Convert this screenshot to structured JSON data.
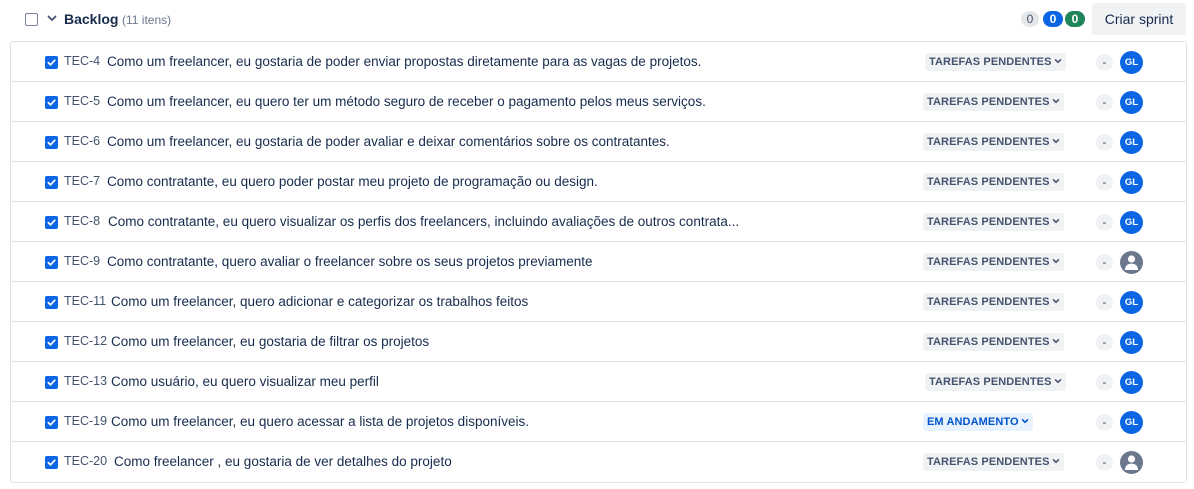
{
  "header": {
    "title": "Backlog",
    "count": "(11 itens)",
    "pill_grey": "0",
    "pill_blue": "0",
    "pill_green": "0",
    "create_sprint": "Criar sprint"
  },
  "colors": {
    "accent_blue": "#0c66e4",
    "done_green": "#1f845a",
    "status_todo_bg": "#f1f2f4",
    "status_progress_bg": "#e9f2ff"
  },
  "issues": [
    {
      "key": "TEC-4",
      "summary": "Como um freelancer, eu gostaria de poder enviar propostas diretamente para as vagas de projetos.",
      "status": "TAREFAS PENDENTES",
      "status_type": "todo",
      "estimate": "-",
      "assignee": "GL"
    },
    {
      "key": "TEC-5",
      "summary": "Como um freelancer, eu quero ter um método seguro de receber o pagamento pelos meus serviços.",
      "status": "TAREFAS PENDENTES",
      "status_type": "todo",
      "estimate": "-",
      "assignee": "GL"
    },
    {
      "key": "TEC-6",
      "summary": "Como um freelancer, eu gostaria de poder avaliar e deixar comentários sobre os contratantes.",
      "status": "TAREFAS PENDENTES",
      "status_type": "todo",
      "estimate": "-",
      "assignee": "GL"
    },
    {
      "key": "TEC-7",
      "summary": "Como contratante, eu quero poder postar meu projeto de programação ou design.",
      "status": "TAREFAS PENDENTES",
      "status_type": "todo",
      "estimate": "-",
      "assignee": "GL"
    },
    {
      "key": "TEC-8",
      "summary": "Como contratante, eu quero visualizar os perfis dos freelancers, incluindo avaliações de outros contrata...",
      "status": "TAREFAS PENDENTES",
      "status_type": "todo",
      "estimate": "-",
      "assignee": "GL"
    },
    {
      "key": "TEC-9",
      "summary": "Como contratante, quero avaliar o freelancer sobre os seus projetos previamente",
      "status": "TAREFAS PENDENTES",
      "status_type": "todo",
      "estimate": "-",
      "assignee": ""
    },
    {
      "key": "TEC-11",
      "summary": "Como um freelancer, quero adicionar e categorizar os trabalhos feitos",
      "status": "TAREFAS PENDENTES",
      "status_type": "todo",
      "estimate": "-",
      "assignee": "GL"
    },
    {
      "key": "TEC-12",
      "summary": "Como um freelancer, eu gostaria de filtrar os projetos",
      "status": "TAREFAS PENDENTES",
      "status_type": "todo",
      "estimate": "-",
      "assignee": "GL"
    },
    {
      "key": "TEC-13",
      "summary": "Como usuário, eu quero visualizar meu perfil",
      "status": "TAREFAS PENDENTES",
      "status_type": "todo",
      "estimate": "-",
      "assignee": "GL"
    },
    {
      "key": "TEC-19",
      "summary": "Como um freelancer, eu quero acessar a lista de projetos disponíveis.",
      "status": "EM ANDAMENTO",
      "status_type": "progress",
      "estimate": "-",
      "assignee": "GL"
    },
    {
      "key": "TEC-20",
      "summary": "Como freelancer , eu gostaria de ver detalhes do projeto",
      "status": "TAREFAS PENDENTES",
      "status_type": "todo",
      "estimate": "-",
      "assignee": ""
    }
  ]
}
